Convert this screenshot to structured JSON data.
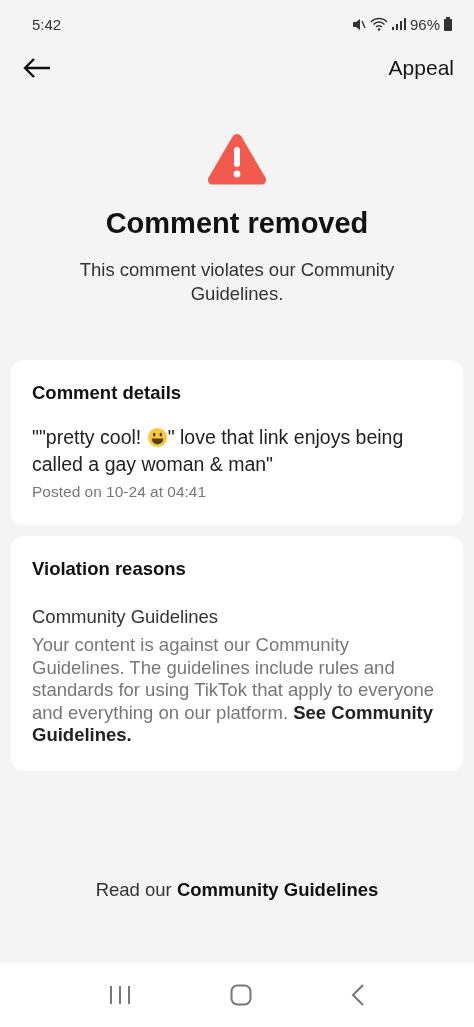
{
  "status_bar": {
    "time": "5:42",
    "battery": "96%"
  },
  "header": {
    "action": "Appeal"
  },
  "notice": {
    "title": "Comment removed",
    "subtitle": "This comment violates our Community Guidelines."
  },
  "comment_card": {
    "title": "Comment details",
    "text_before": "\"\"pretty cool! ",
    "text_after": "\" love that link enjoys being",
    "text_line2": "called a gay woman & man\"",
    "posted": "Posted on 10-24 at 04:41"
  },
  "violation_card": {
    "title": "Violation reasons",
    "reason": "Community Guidelines",
    "description": "Your content is against our Community Guidelines. The guidelines include rules and standards for using TikTok that apply to everyone and everything on our platform. **See Community Guidelines.**"
  },
  "footer": {
    "text": "Read our **Community Guidelines**"
  }
}
